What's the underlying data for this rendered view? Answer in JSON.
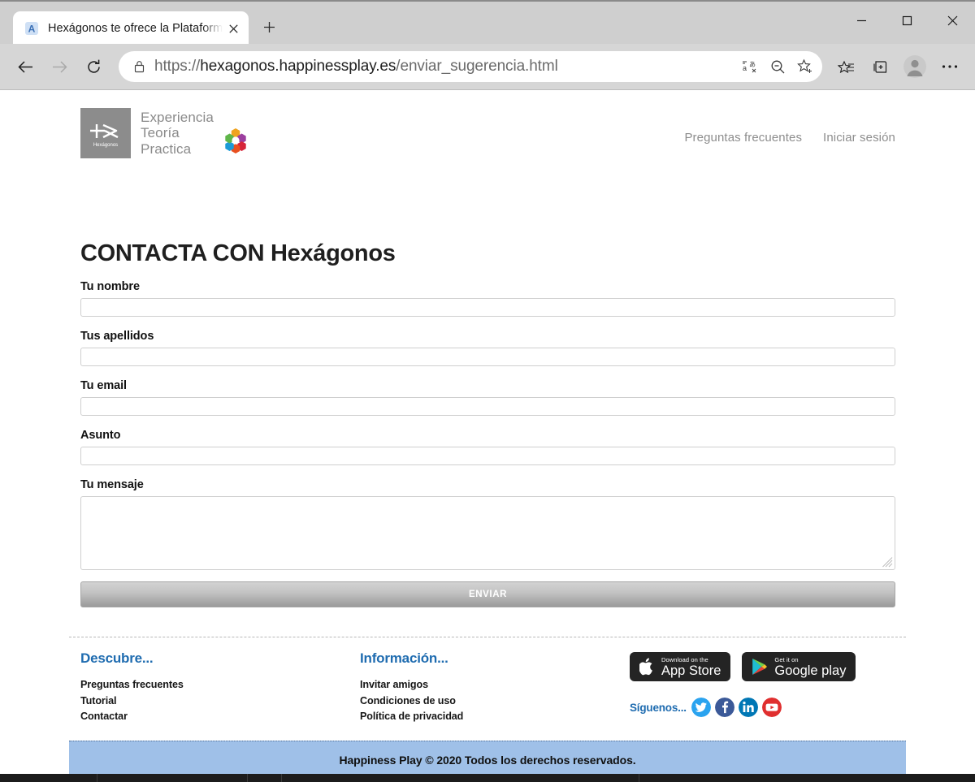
{
  "browser": {
    "tab": {
      "title": "Hexágonos te ofrece la Plataform",
      "favicon": "letter-a-favicon"
    },
    "newtab_label": "+",
    "window": {
      "minimize": "—",
      "maximize": "□",
      "close": "✕"
    },
    "url": {
      "scheme": "https://",
      "host": "hexagonos.happinessplay.es",
      "path": "/enviar_sugerencia.html"
    },
    "icons": {
      "back": "back-arrow-icon",
      "forward": "forward-arrow-icon",
      "reload": "reload-icon",
      "lock": "lock-icon",
      "translate": "translate-icon",
      "zoom_out": "zoom-out-icon",
      "favorite": "add-favorite-star-icon",
      "favorites_bar": "favorites-icon",
      "collections": "collections-icon",
      "profile": "profile-avatar-icon",
      "settings": "more-options-icon"
    }
  },
  "site": {
    "logo": {
      "mark_text": "Hexágonos",
      "lines": [
        "Experiencia",
        "Teoría",
        "Practica"
      ]
    },
    "nav": [
      {
        "label": "Preguntas frecuentes"
      },
      {
        "label": "Iniciar sesión"
      }
    ]
  },
  "main": {
    "title": "CONTACTA CON Hexágonos",
    "fields": [
      {
        "label": "Tu nombre",
        "value": "",
        "placeholder": "",
        "type": "text"
      },
      {
        "label": "Tus apellidos",
        "value": "",
        "placeholder": "",
        "type": "text"
      },
      {
        "label": "Tu email",
        "value": "",
        "placeholder": "",
        "type": "email"
      },
      {
        "label": "Asunto",
        "value": "",
        "placeholder": "",
        "type": "text"
      }
    ],
    "message": {
      "label": "Tu mensaje",
      "value": "",
      "placeholder": ""
    },
    "submit_label": "ENVIAR"
  },
  "footer": {
    "columns": [
      {
        "title": "Descubre...",
        "links": [
          "Preguntas frecuentes",
          "Tutorial",
          "Contactar"
        ]
      },
      {
        "title": "Información...",
        "links": [
          "Invitar amigos",
          "Condiciones de uso",
          "Política de privacidad"
        ]
      }
    ],
    "badges": [
      {
        "name": "app-store-badge",
        "sub": "Download on the",
        "main": "App Store"
      },
      {
        "name": "google-play-badge",
        "sub": "Get it on",
        "main": "Google play"
      }
    ],
    "social": {
      "label": "Síguenos...",
      "icons": [
        "twitter-icon",
        "facebook-icon",
        "linkedin-icon",
        "youtube-icon"
      ]
    },
    "copyright": "Happiness Play © 2020 Todos los derechos reservados."
  },
  "colors": {
    "footer_heading": "#1f6cb0",
    "copyright_bg": "#9fc0e8",
    "logo_gray": "#8c8c8c"
  }
}
